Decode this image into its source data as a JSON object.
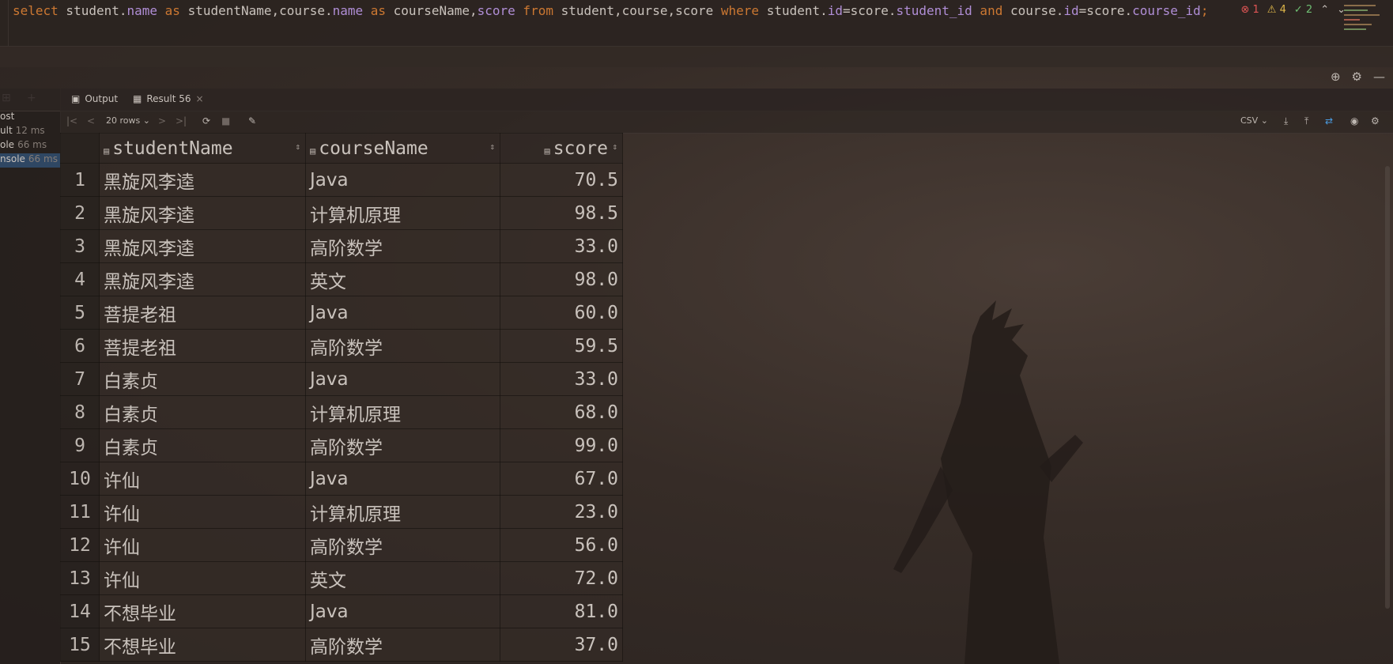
{
  "editor": {
    "sql_parts": [
      {
        "t": "select",
        "c": "kw"
      },
      {
        "t": " student.",
        "c": ""
      },
      {
        "t": "name",
        "c": "fld"
      },
      {
        "t": " as ",
        "c": "kw"
      },
      {
        "t": "studentName,course.",
        "c": ""
      },
      {
        "t": "name",
        "c": "fld"
      },
      {
        "t": " as ",
        "c": "kw"
      },
      {
        "t": "courseName,",
        "c": ""
      },
      {
        "t": "score",
        "c": "fld"
      },
      {
        "t": " from ",
        "c": "kw"
      },
      {
        "t": "student,course,score ",
        "c": ""
      },
      {
        "t": "where",
        "c": "kw"
      },
      {
        "t": " student.",
        "c": ""
      },
      {
        "t": "id",
        "c": "fld"
      },
      {
        "t": "=score.",
        "c": ""
      },
      {
        "t": "student_id",
        "c": "fld"
      },
      {
        "t": " and ",
        "c": "kw"
      },
      {
        "t": "course.",
        "c": ""
      },
      {
        "t": "id",
        "c": "fld"
      },
      {
        "t": "=score.",
        "c": ""
      },
      {
        "t": "course_id",
        "c": "fld"
      },
      {
        "t": ";",
        "c": "semi"
      }
    ],
    "inspections": {
      "errors": "1",
      "warnings": "4",
      "weak": "2"
    }
  },
  "tabs": {
    "output": "Output",
    "result": "Result 56"
  },
  "left_panel": {
    "items": [
      {
        "label": "ost",
        "ms": ""
      },
      {
        "label": "ult",
        "ms": "12 ms"
      },
      {
        "label": "ole",
        "ms": "66 ms"
      },
      {
        "label": "nsole",
        "ms": "66 ms"
      }
    ]
  },
  "toolbar": {
    "rows": "20 rows",
    "format": "CSV"
  },
  "columns": [
    "studentName",
    "courseName",
    "score"
  ],
  "rows": [
    [
      "1",
      "黑旋风李逵",
      "Java",
      "70.5"
    ],
    [
      "2",
      "黑旋风李逵",
      "计算机原理",
      "98.5"
    ],
    [
      "3",
      "黑旋风李逵",
      "高阶数学",
      "33.0"
    ],
    [
      "4",
      "黑旋风李逵",
      "英文",
      "98.0"
    ],
    [
      "5",
      "菩提老祖",
      "Java",
      "60.0"
    ],
    [
      "6",
      "菩提老祖",
      "高阶数学",
      "59.5"
    ],
    [
      "7",
      "白素贞",
      "Java",
      "33.0"
    ],
    [
      "8",
      "白素贞",
      "计算机原理",
      "68.0"
    ],
    [
      "9",
      "白素贞",
      "高阶数学",
      "99.0"
    ],
    [
      "10",
      "许仙",
      "Java",
      "67.0"
    ],
    [
      "11",
      "许仙",
      "计算机原理",
      "23.0"
    ],
    [
      "12",
      "许仙",
      "高阶数学",
      "56.0"
    ],
    [
      "13",
      "许仙",
      "英文",
      "72.0"
    ],
    [
      "14",
      "不想毕业",
      "Java",
      "81.0"
    ],
    [
      "15",
      "不想毕业",
      "高阶数学",
      "37.0"
    ]
  ]
}
